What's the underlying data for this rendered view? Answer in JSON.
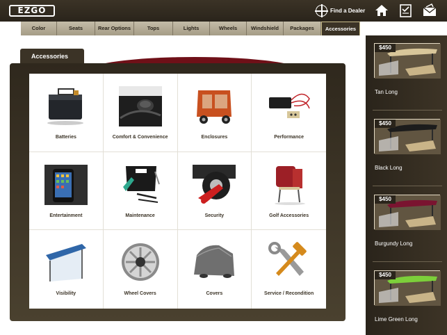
{
  "header": {
    "logo": "EZGO",
    "find_dealer": "Find a Dealer",
    "icons": [
      "home-icon",
      "checklist-icon",
      "mail-icon"
    ]
  },
  "nav": {
    "items": [
      "Color",
      "Seats",
      "Rear Options",
      "Tops",
      "Lights",
      "Wheels",
      "Windshield",
      "Packages",
      "Accessories"
    ],
    "active": "Accessories"
  },
  "section": {
    "tab": "Accessories"
  },
  "categories": [
    {
      "label": "Batteries",
      "icon": "battery-icon"
    },
    {
      "label": "Comfort & Convenience",
      "icon": "cupholder-icon"
    },
    {
      "label": "Enclosures",
      "icon": "enclosure-icon"
    },
    {
      "label": "Performance",
      "icon": "wiring-icon"
    },
    {
      "label": "Entertainment",
      "icon": "phone-icon"
    },
    {
      "label": "Maintenance",
      "icon": "tools-kit-icon"
    },
    {
      "label": "Security",
      "icon": "wheel-lock-icon"
    },
    {
      "label": "Golf Accessories",
      "icon": "bag-holder-icon"
    },
    {
      "label": "Visibility",
      "icon": "windshield-icon"
    },
    {
      "label": "Wheel Covers",
      "icon": "wheel-cover-icon"
    },
    {
      "label": "Covers",
      "icon": "cart-cover-icon"
    },
    {
      "label": "Service / Recondition",
      "icon": "wrench-hammer-icon"
    }
  ],
  "sidebar": {
    "items": [
      {
        "price": "$450",
        "name": "Tan Long",
        "roof_color": "#d8c69a"
      },
      {
        "price": "$450",
        "name": "Black Long",
        "roof_color": "#1c1c1c"
      },
      {
        "price": "$450",
        "name": "Burgundy Long",
        "roof_color": "#7a1430"
      },
      {
        "price": "$450",
        "name": "Lime Green Long",
        "roof_color": "#7ccf3a"
      }
    ]
  },
  "colors": {
    "header_bg": "#2a241b",
    "nav_bg": "#b3aa93",
    "accent_swoosh": "#6f1018"
  }
}
